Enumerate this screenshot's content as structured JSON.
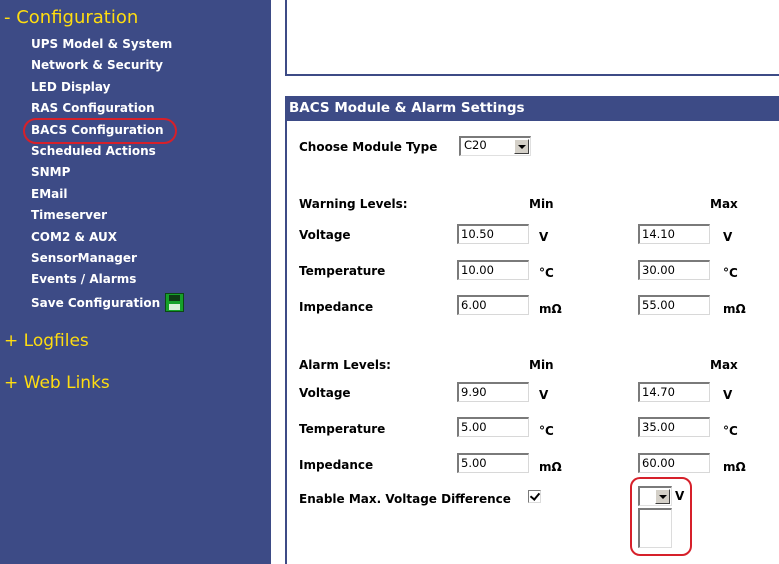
{
  "sidebar": {
    "configuration_heading": "- Configuration",
    "items": [
      {
        "label": "UPS Model & System"
      },
      {
        "label": "Network & Security"
      },
      {
        "label": "LED Display"
      },
      {
        "label": "RAS Configuration"
      },
      {
        "label": "BACS Configuration"
      },
      {
        "label": "Scheduled Actions"
      },
      {
        "label": "SNMP"
      },
      {
        "label": "EMail"
      },
      {
        "label": "Timeserver"
      },
      {
        "label": "COM2 & AUX"
      },
      {
        "label": "SensorManager"
      },
      {
        "label": "Events / Alarms"
      },
      {
        "label": "Save Configuration"
      }
    ],
    "logfiles_heading": "+ Logfiles",
    "weblinks_heading": "+ Web Links"
  },
  "panel": {
    "title": "BACS Module & Alarm Settings",
    "module_type_label": "Choose Module Type",
    "module_type_value": "C20",
    "warning": {
      "heading": "Warning Levels:",
      "min_label": "Min",
      "max_label": "Max",
      "rows": [
        {
          "label": "Voltage",
          "min": "10.50",
          "max": "14.10",
          "unit": "V"
        },
        {
          "label": "Temperature",
          "min": "10.00",
          "max": "30.00",
          "unit": "°C"
        },
        {
          "label": "Impedance",
          "min": "6.00",
          "max": "55.00",
          "unit": "mΩ"
        }
      ]
    },
    "alarm": {
      "heading": "Alarm Levels:",
      "min_label": "Min",
      "max_label": "Max",
      "rows": [
        {
          "label": "Voltage",
          "min": "9.90",
          "max": "14.70",
          "unit": "V"
        },
        {
          "label": "Temperature",
          "min": "5.00",
          "max": "35.00",
          "unit": "°C"
        },
        {
          "label": "Impedance",
          "min": "5.00",
          "max": "60.00",
          "unit": "mΩ"
        }
      ]
    },
    "voltage_diff_label": "Enable Max. Voltage Difference",
    "voltage_diff_checked": true,
    "voltage_diff_unit": "V"
  },
  "colors": {
    "sidebar_bg": "#3d4b86",
    "heading_yellow": "#ffdd10",
    "highlight_red": "#d6202a"
  }
}
